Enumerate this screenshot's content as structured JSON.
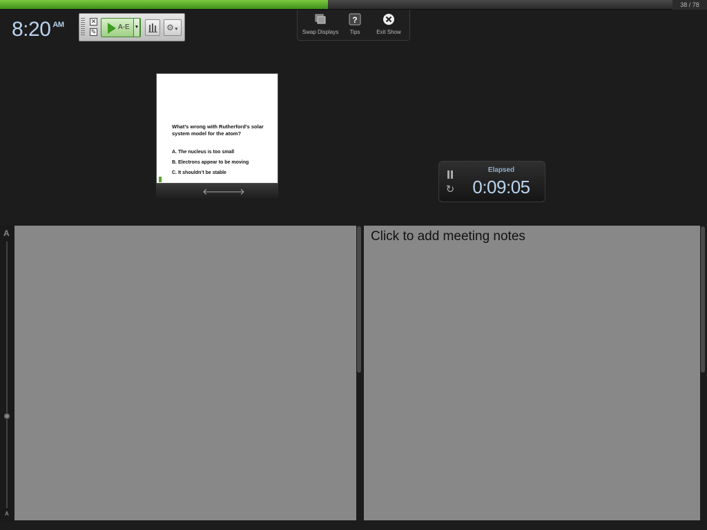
{
  "progress": {
    "current_slide": 38,
    "total_slides": 78,
    "counter_text": "38 / 78",
    "fill_color": "#5aa72b"
  },
  "clock": {
    "time": "8:20",
    "ampm": "AM"
  },
  "clicker_toolbar": {
    "start_poll_label": "A-E",
    "icons": [
      "close-icon",
      "edit-icon",
      "play-icon",
      "dropdown-arrow-icon",
      "bar-chart-icon",
      "gear-icon"
    ]
  },
  "top_menu": {
    "items": [
      {
        "label": "Swap Displays",
        "icon": "swap-displays-icon"
      },
      {
        "label": "Tips",
        "icon": "help-icon"
      },
      {
        "label": "Exit Show",
        "icon": "close-circle-icon"
      }
    ]
  },
  "slide_preview": {
    "question": "What’s wrong with Rutherford’s solar system model for the atom?",
    "options": [
      "A. The nucleus is too small",
      "B. Electrons appear to be moving",
      "C. It shouldn’t be stable"
    ]
  },
  "timer": {
    "label": "Elapsed",
    "value": "0:09:05"
  },
  "notes": {
    "font_size_large": "A",
    "font_size_small": "A",
    "placeholder": "Click to add meeting notes"
  }
}
